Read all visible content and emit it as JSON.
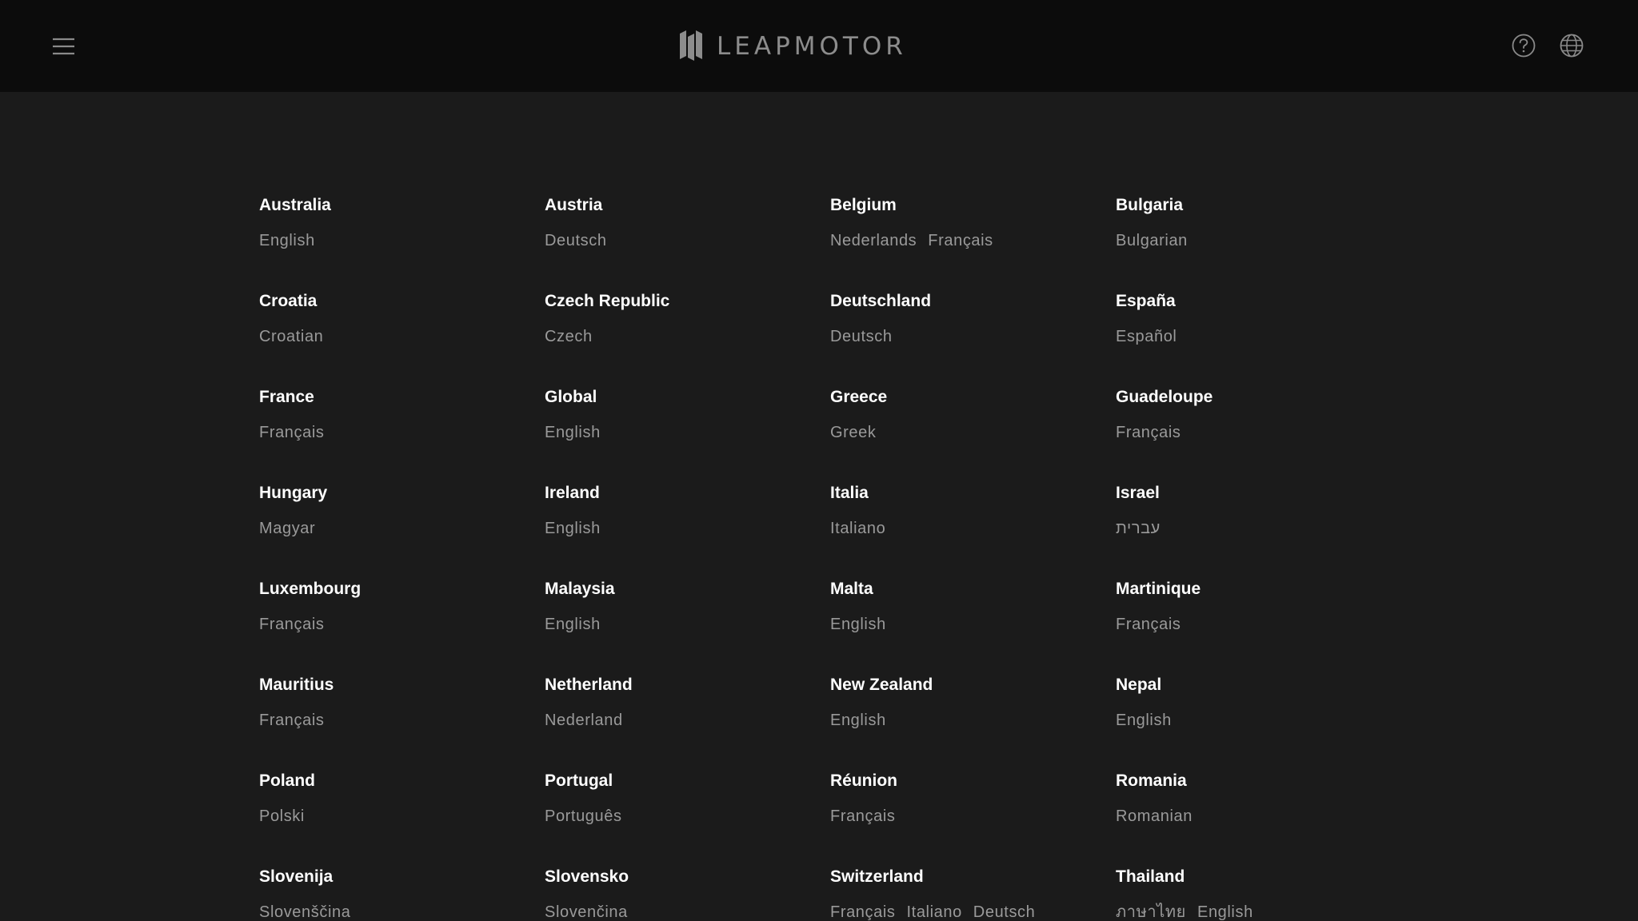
{
  "header": {
    "menu_icon": "hamburger-menu-icon",
    "brand": "LEAPMOTOR",
    "help_icon": "question-circle-icon",
    "language_icon": "globe-icon"
  },
  "colors": {
    "header_bg": "#0c0c0c",
    "page_bg": "#1b1b1b",
    "country_text": "#ffffff",
    "language_text": "#9a9a9a",
    "icon_stroke": "#8a8a8a"
  },
  "countries": [
    {
      "name": "Australia",
      "languages": [
        "English"
      ]
    },
    {
      "name": "Austria",
      "languages": [
        "Deutsch"
      ]
    },
    {
      "name": "Belgium",
      "languages": [
        "Nederlands",
        "Français"
      ]
    },
    {
      "name": "Bulgaria",
      "languages": [
        "Bulgarian"
      ]
    },
    {
      "name": "Croatia",
      "languages": [
        "Croatian"
      ]
    },
    {
      "name": "Czech Republic",
      "languages": [
        "Czech"
      ]
    },
    {
      "name": "Deutschland",
      "languages": [
        "Deutsch"
      ]
    },
    {
      "name": "España",
      "languages": [
        "Español"
      ]
    },
    {
      "name": "France",
      "languages": [
        "Français"
      ]
    },
    {
      "name": "Global",
      "languages": [
        "English"
      ]
    },
    {
      "name": "Greece",
      "languages": [
        "Greek"
      ]
    },
    {
      "name": "Guadeloupe",
      "languages": [
        "Français"
      ]
    },
    {
      "name": "Hungary",
      "languages": [
        "Magyar"
      ]
    },
    {
      "name": "Ireland",
      "languages": [
        "English"
      ]
    },
    {
      "name": "Italia",
      "languages": [
        "Italiano"
      ]
    },
    {
      "name": "Israel",
      "languages": [
        "עברית"
      ]
    },
    {
      "name": "Luxembourg",
      "languages": [
        "Français"
      ]
    },
    {
      "name": "Malaysia",
      "languages": [
        "English"
      ]
    },
    {
      "name": "Malta",
      "languages": [
        "English"
      ]
    },
    {
      "name": "Martinique",
      "languages": [
        "Français"
      ]
    },
    {
      "name": "Mauritius",
      "languages": [
        "Français"
      ]
    },
    {
      "name": "Netherland",
      "languages": [
        "Nederland"
      ]
    },
    {
      "name": "New Zealand",
      "languages": [
        "English"
      ]
    },
    {
      "name": "Nepal",
      "languages": [
        "English"
      ]
    },
    {
      "name": "Poland",
      "languages": [
        "Polski"
      ]
    },
    {
      "name": "Portugal",
      "languages": [
        "Português"
      ]
    },
    {
      "name": "Réunion",
      "languages": [
        "Français"
      ]
    },
    {
      "name": "Romania",
      "languages": [
        "Romanian"
      ]
    },
    {
      "name": "Slovenija",
      "languages": [
        "Slovenščina"
      ]
    },
    {
      "name": "Slovensko",
      "languages": [
        "Slovenčina"
      ]
    },
    {
      "name": "Switzerland",
      "languages": [
        "Français",
        "Italiano",
        "Deutsch"
      ]
    },
    {
      "name": "Thailand",
      "languages": [
        "ภาษาไทย",
        "English"
      ]
    }
  ]
}
